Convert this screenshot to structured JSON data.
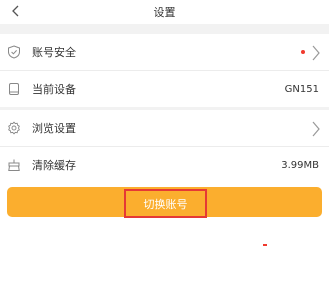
{
  "header": {
    "title": "设置"
  },
  "settings": {
    "account_security": {
      "label": "账号安全",
      "has_dot": true
    },
    "current_device": {
      "label": "当前设备",
      "value": "GN151"
    },
    "browse_settings": {
      "label": "浏览设置"
    },
    "clear_cache": {
      "label": "清除缓存",
      "value": "3.99MB"
    }
  },
  "actions": {
    "switch_account_label": "切换账号"
  },
  "colors": {
    "accent": "#fbae2e",
    "alert": "#f03a2e",
    "highlight_border": "#e53935",
    "divider_background": "#f2f2f2"
  }
}
